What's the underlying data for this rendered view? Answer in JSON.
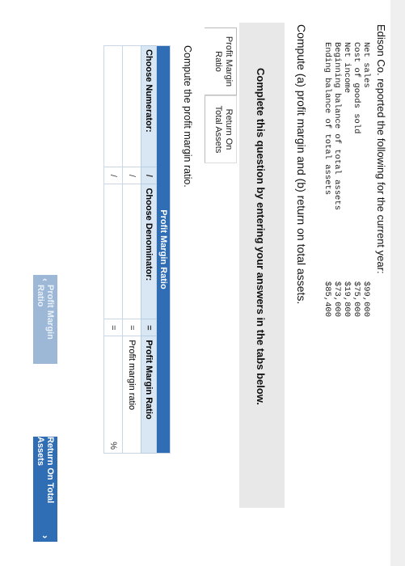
{
  "intro": "Edison Co. reported the following for the current year:",
  "financials": [
    {
      "label": "Net sales",
      "value": "$99,000"
    },
    {
      "label": "Cost of goods sold",
      "value": "$75,000"
    },
    {
      "label": "Net income",
      "value": "$19,800"
    },
    {
      "label": "Beginning balance of total assets",
      "value": "$73,000"
    },
    {
      "label": "Ending balance of total assets",
      "value": "$85,400"
    }
  ],
  "question": "Compute (a) profit margin and (b) return on total assets.",
  "instructions": "Complete this question by entering your answers in the tabs below.",
  "tabs": [
    {
      "line1": "Profit Margin",
      "line2": "Ratio"
    },
    {
      "line1": "Return On",
      "line2": "Total Assets"
    }
  ],
  "compute_prompt": "Compute the profit margin ratio.",
  "table": {
    "header": "Profit Margin Ratio",
    "numerator_label": "Choose Numerator:",
    "divider": "/",
    "denominator_label": "Choose Denominator:",
    "equals": "=",
    "result_label": "Profit Margin Ratio",
    "result_row_text": "Profit margin ratio",
    "percent": "%"
  },
  "nav": {
    "prev_label": "Profit Margin Ratio",
    "next_label": "Return On Total Assets"
  }
}
